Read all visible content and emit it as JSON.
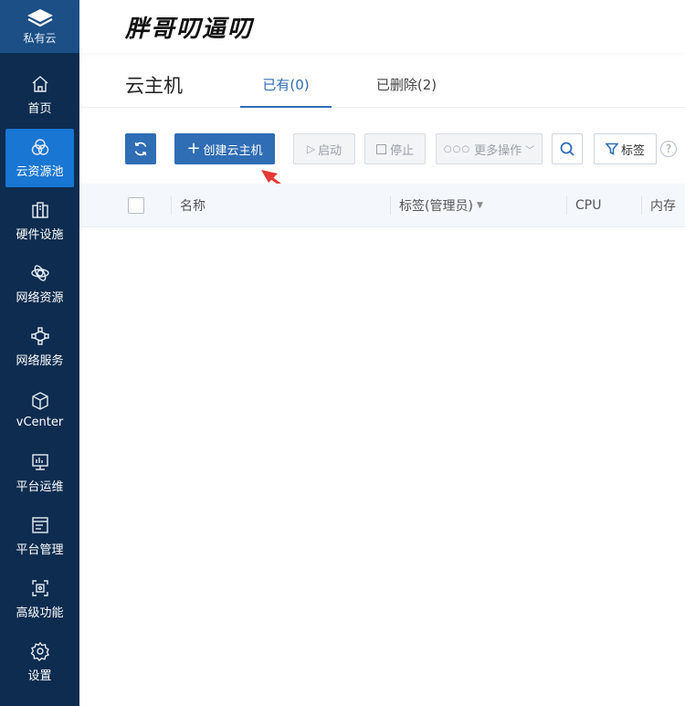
{
  "brand": {
    "label": "私有云"
  },
  "sidebar": {
    "items": [
      {
        "label": "首页",
        "icon": "home-icon"
      },
      {
        "label": "云资源池",
        "icon": "resource-pool-icon",
        "active": true
      },
      {
        "label": "硬件设施",
        "icon": "hardware-icon"
      },
      {
        "label": "网络资源",
        "icon": "network-resource-icon"
      },
      {
        "label": "网络服务",
        "icon": "network-service-icon"
      },
      {
        "label": "vCenter",
        "icon": "cube-icon"
      },
      {
        "label": "平台运维",
        "icon": "monitor-icon"
      },
      {
        "label": "平台管理",
        "icon": "window-icon"
      },
      {
        "label": "高级功能",
        "icon": "advanced-icon"
      },
      {
        "label": "设置",
        "icon": "gear-icon"
      }
    ]
  },
  "header": {
    "site_title": "胖哥叨逼叨"
  },
  "page": {
    "title": "云主机",
    "tabs": [
      {
        "label": "已有(0)",
        "active": true
      },
      {
        "label": "已删除(2)",
        "active": false
      }
    ]
  },
  "toolbar": {
    "create_label": "创建云主机",
    "start_label": "启动",
    "stop_label": "停止",
    "more_label": "更多操作",
    "tag_label": "标签",
    "help_label": "?"
  },
  "table": {
    "columns": [
      "名称",
      "标签(管理员)",
      "CPU",
      "内存"
    ]
  },
  "colors": {
    "sidebar_bg": "#0d2c4f",
    "brand_bg": "#1b4f85",
    "active_nav": "#1976d2",
    "primary": "#2f6db5",
    "arrow": "#e53935"
  }
}
